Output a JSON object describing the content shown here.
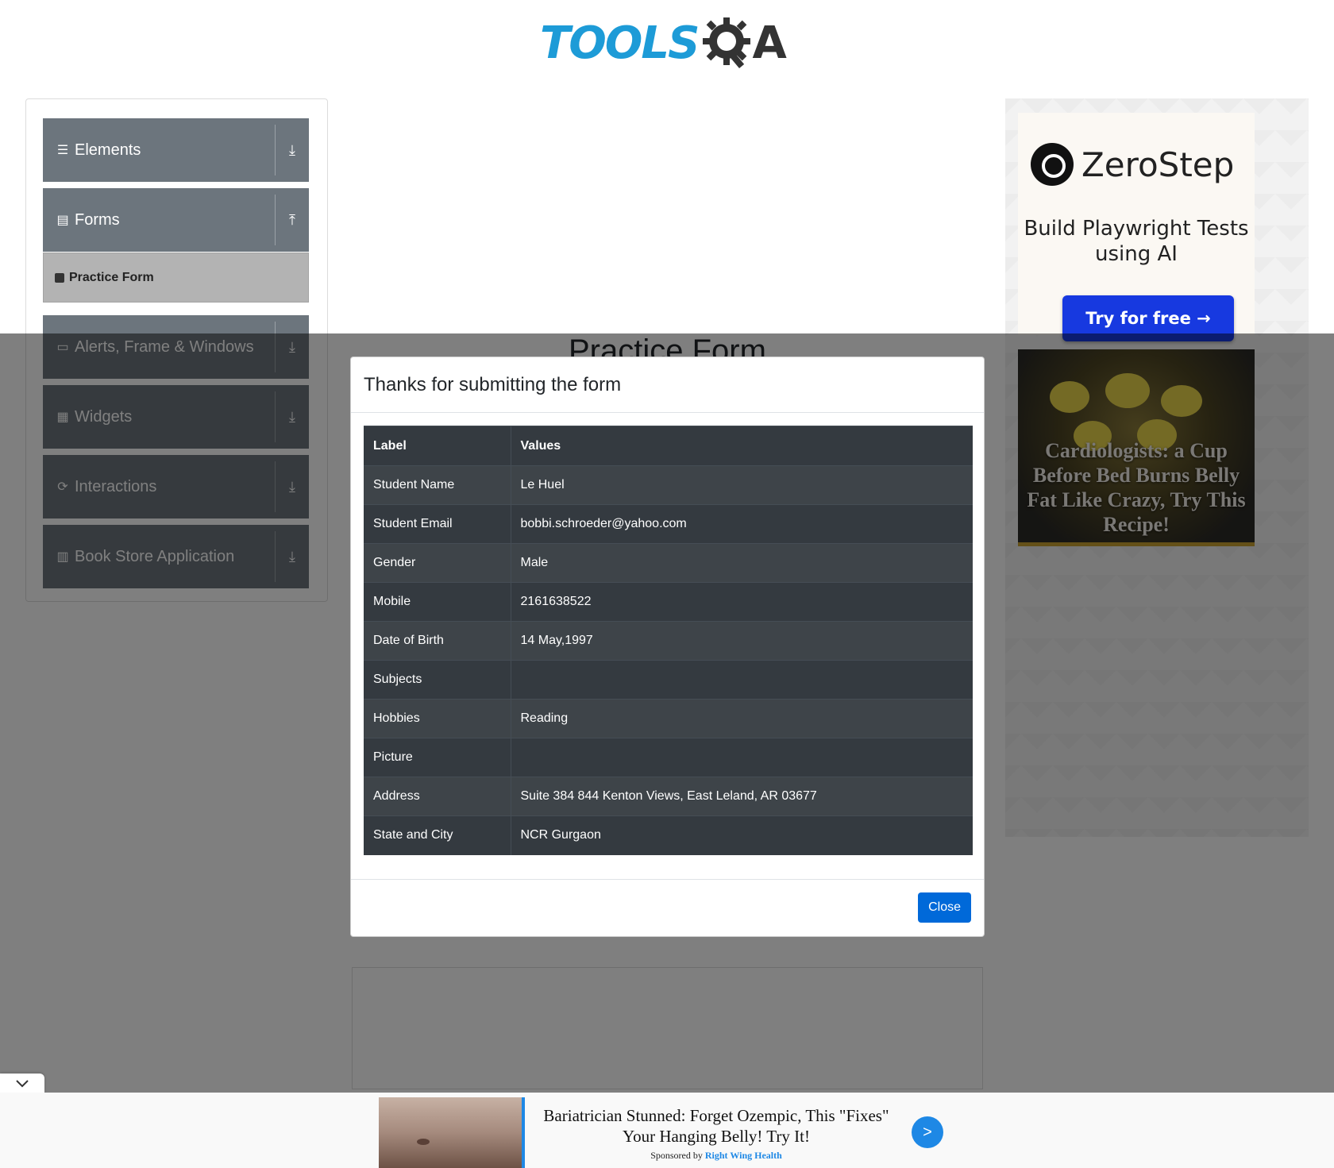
{
  "logo": {
    "text_left": "TOOLS",
    "text_right": "A"
  },
  "sidebar": {
    "groups": [
      {
        "label": "Elements",
        "icon": "menu-icon",
        "arrow": "⤓"
      },
      {
        "label": "Forms",
        "icon": "document-icon",
        "arrow": "⤒"
      },
      {
        "label": "Alerts, Frame & Windows",
        "icon": "window-icon",
        "arrow": "⤓"
      },
      {
        "label": "Widgets",
        "icon": "widgets-icon",
        "arrow": "⤓"
      },
      {
        "label": "Interactions",
        "icon": "interactions-icon",
        "arrow": "⤓"
      },
      {
        "label": "Book Store Application",
        "icon": "books-icon",
        "arrow": "⤓"
      }
    ],
    "active_sub_item": "Practice Form"
  },
  "page": {
    "title": "Practice Form"
  },
  "ads": {
    "zerostep": {
      "name": "ZeroStep",
      "tagline": "Build Playwright Tests using AI",
      "cta": "Try for free →"
    },
    "food": {
      "headline": "Cardiologists: a Cup Before Bed Burns Belly Fat Like Crazy, Try This Recipe!"
    },
    "sticky": {
      "headline": "Bariatrician Stunned: Forget Ozempic, This \"Fixes\" Your Hanging Belly! Try It!",
      "sponsored_prefix": "Sponsored by",
      "sponsor": "Right Wing Health",
      "go_label": ">"
    }
  },
  "modal": {
    "title": "Thanks for submitting the form",
    "columns": [
      "Label",
      "Values"
    ],
    "rows": [
      [
        "Student Name",
        "Le Huel"
      ],
      [
        "Student Email",
        "bobbi.schroeder@yahoo.com"
      ],
      [
        "Gender",
        "Male"
      ],
      [
        "Mobile",
        "2161638522"
      ],
      [
        "Date of Birth",
        "14 May,1997"
      ],
      [
        "Subjects",
        ""
      ],
      [
        "Hobbies",
        "Reading"
      ],
      [
        "Picture",
        ""
      ],
      [
        "Address",
        "Suite 384 844 Kenton Views, East Leland, AR 03677"
      ],
      [
        "State and City",
        "NCR Gurgaon"
      ]
    ],
    "close_label": "Close"
  },
  "colors": {
    "sidebar_group": "#6c757d",
    "primary": "#0069d9",
    "brand_blue": "#1d9bd7"
  }
}
